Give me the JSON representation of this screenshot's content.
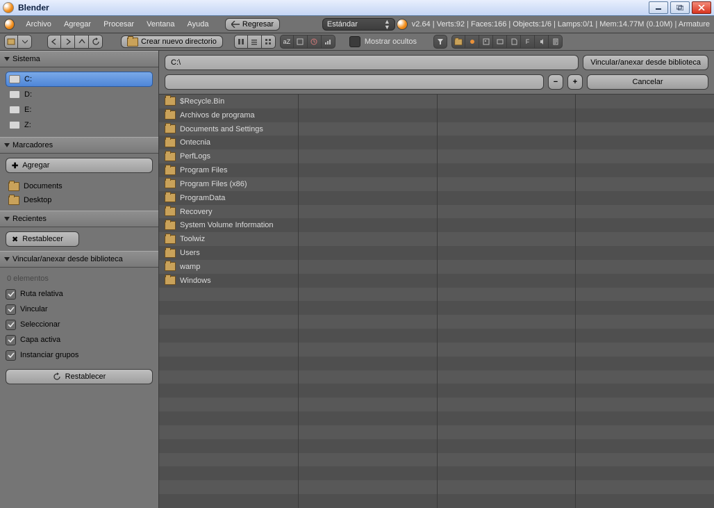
{
  "titlebar": {
    "title": "Blender"
  },
  "menubar": {
    "items": [
      "Archivo",
      "Agregar",
      "Procesar",
      "Ventana",
      "Ayuda"
    ],
    "back_label": "Regresar",
    "shading_label": "Estándar",
    "stats": "v2.64 | Verts:92 | Faces:166 | Objects:1/6 | Lamps:0/1 | Mem:14.77M (0.10M) | Armature"
  },
  "toolbar": {
    "newdir_label": "Crear nuevo directorio",
    "showhidden_label": "Mostrar ocultos"
  },
  "pathbar": {
    "path_value": "C:\\",
    "filename_value": "",
    "action_label": "Vincular/anexar desde biblioteca",
    "cancel_label": "Cancelar"
  },
  "sidebar": {
    "system_header": "Sistema",
    "drives": [
      "C:",
      "D:",
      "E:",
      "Z:"
    ],
    "bookmarks_header": "Marcadores",
    "add_label": "Agregar",
    "bookmarks": [
      "Documents",
      "Desktop"
    ],
    "recent_header": "Recientes",
    "reset_label": "Restablecer",
    "link_header": "Vincular/anexar desde biblioteca",
    "elements_label": "0 elementos",
    "opts": {
      "rel": "Ruta relativa",
      "link": "Vincular",
      "select": "Seleccionar",
      "active": "Capa activa",
      "inst": "Instanciar grupos"
    },
    "reset2_label": "Restablecer"
  },
  "files": [
    "$Recycle.Bin",
    "Archivos de programa",
    "Documents and Settings",
    "Ontecnia",
    "PerfLogs",
    "Program Files",
    "Program Files (x86)",
    "ProgramData",
    "Recovery",
    "System Volume Information",
    "Toolwiz",
    "Users",
    "wamp",
    "Windows"
  ]
}
